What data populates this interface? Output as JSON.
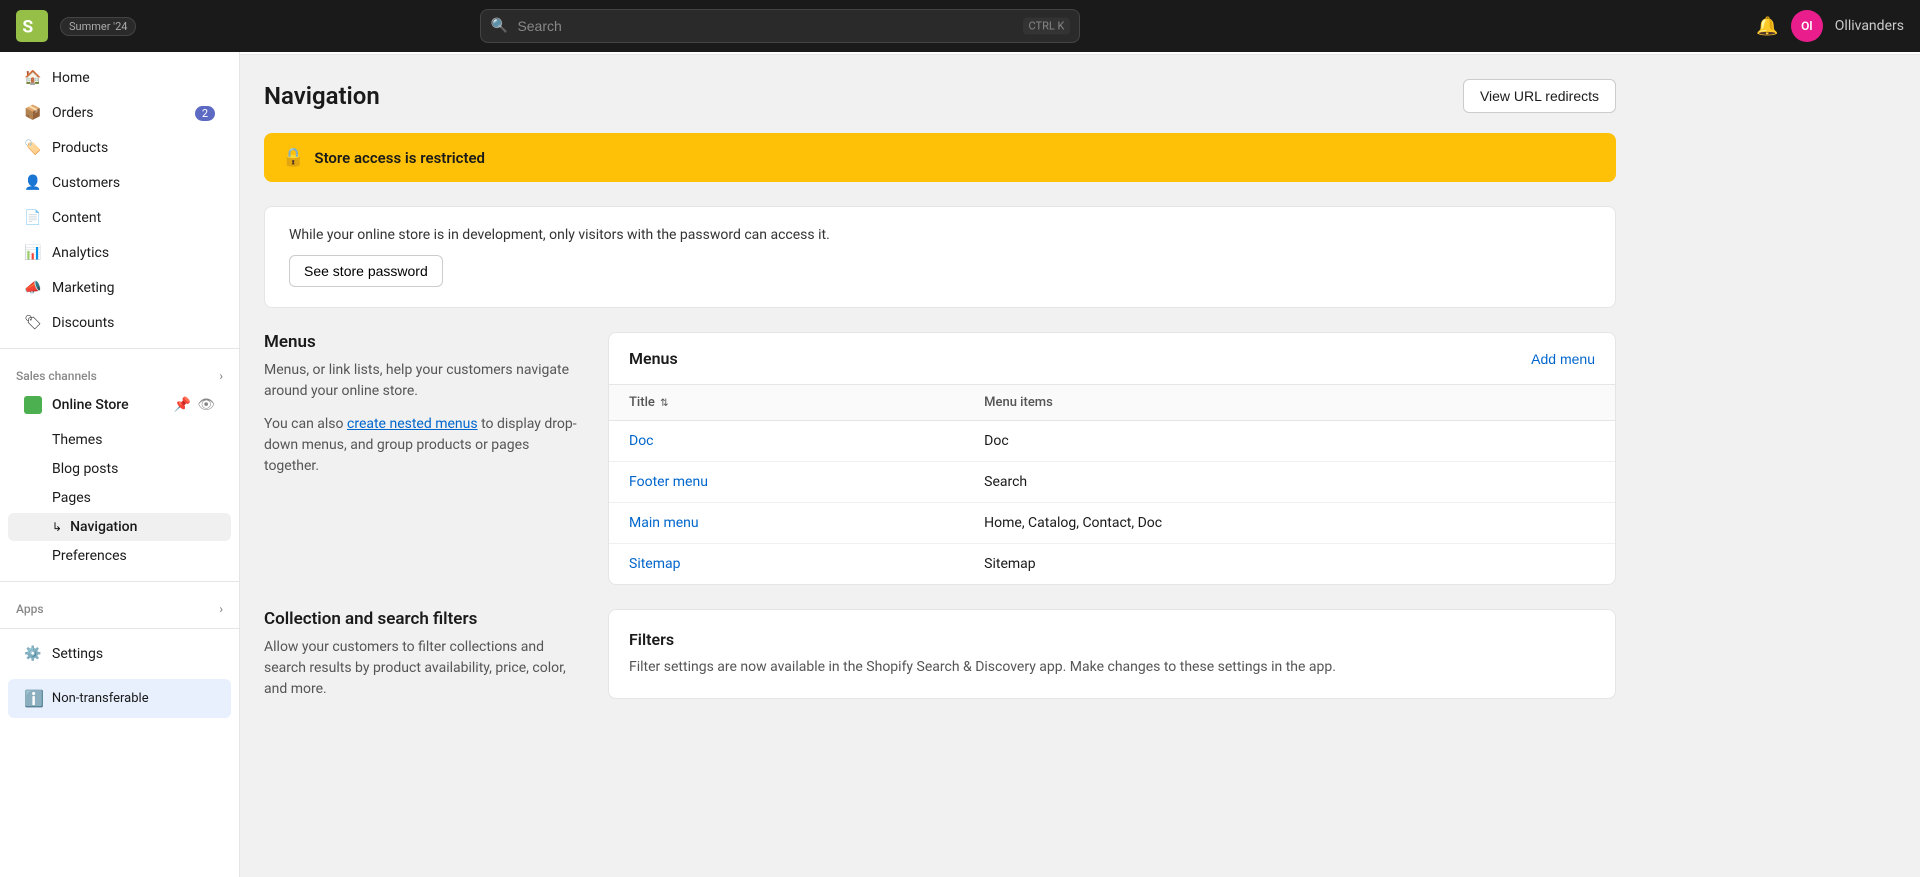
{
  "topbar": {
    "logo_text": "shopify",
    "badge_text": "Summer '24",
    "search_placeholder": "Search",
    "search_shortcut": "CTRL K",
    "notification_icon": "🔔",
    "avatar_initials": "Ol",
    "avatar_color": "#e91e8c",
    "username": "Ollivanders"
  },
  "sidebar": {
    "items": [
      {
        "id": "home",
        "label": "Home",
        "icon": "🏠"
      },
      {
        "id": "orders",
        "label": "Orders",
        "icon": "📦",
        "badge": "2"
      },
      {
        "id": "products",
        "label": "Products",
        "icon": "🏷️"
      },
      {
        "id": "customers",
        "label": "Customers",
        "icon": "👤"
      },
      {
        "id": "content",
        "label": "Content",
        "icon": "📄"
      },
      {
        "id": "analytics",
        "label": "Analytics",
        "icon": "📊"
      },
      {
        "id": "marketing",
        "label": "Marketing",
        "icon": "📣"
      },
      {
        "id": "discounts",
        "label": "Discounts",
        "icon": "🏷"
      }
    ],
    "sales_channels_label": "Sales channels",
    "online_store": {
      "label": "Online Store",
      "icon": "🟩"
    },
    "sub_items": [
      {
        "id": "themes",
        "label": "Themes"
      },
      {
        "id": "blog-posts",
        "label": "Blog posts"
      },
      {
        "id": "pages",
        "label": "Pages"
      },
      {
        "id": "navigation",
        "label": "Navigation",
        "active": true
      },
      {
        "id": "preferences",
        "label": "Preferences"
      }
    ],
    "apps_label": "Apps",
    "settings_label": "Settings",
    "non_transferable_label": "Non-transferable"
  },
  "sub_topbar": {
    "icon": "🟩",
    "title": "Online Store"
  },
  "page": {
    "title": "Navigation",
    "view_url_btn": "View URL redirects"
  },
  "warning": {
    "banner_text": "Store access is restricted",
    "card_text": "While your online store is in development, only visitors with the password can access it.",
    "password_btn": "See store password"
  },
  "menus_section": {
    "title": "Menus",
    "desc1": "Menus, or link lists, help your customers navigate around your online store.",
    "desc2": "You can also",
    "link_text": "create nested menus",
    "desc3": "to display drop-down menus, and group products or pages together."
  },
  "menus_table": {
    "title": "Menus",
    "add_btn": "Add menu",
    "col_title": "Title",
    "col_menu_items": "Menu items",
    "rows": [
      {
        "title": "Doc",
        "items": "Doc"
      },
      {
        "title": "Footer menu",
        "items": "Search"
      },
      {
        "title": "Main menu",
        "items": "Home, Catalog, Contact, Doc"
      },
      {
        "title": "Sitemap",
        "items": "Sitemap"
      }
    ]
  },
  "filters_section": {
    "left_title": "Collection and search filters",
    "left_desc": "Allow your customers to filter collections and search results by product availability, price, color, and more.",
    "right_title": "Filters",
    "right_desc": "Filter settings are now available in the Shopify Search & Discovery app. Make changes to these settings in the app."
  }
}
